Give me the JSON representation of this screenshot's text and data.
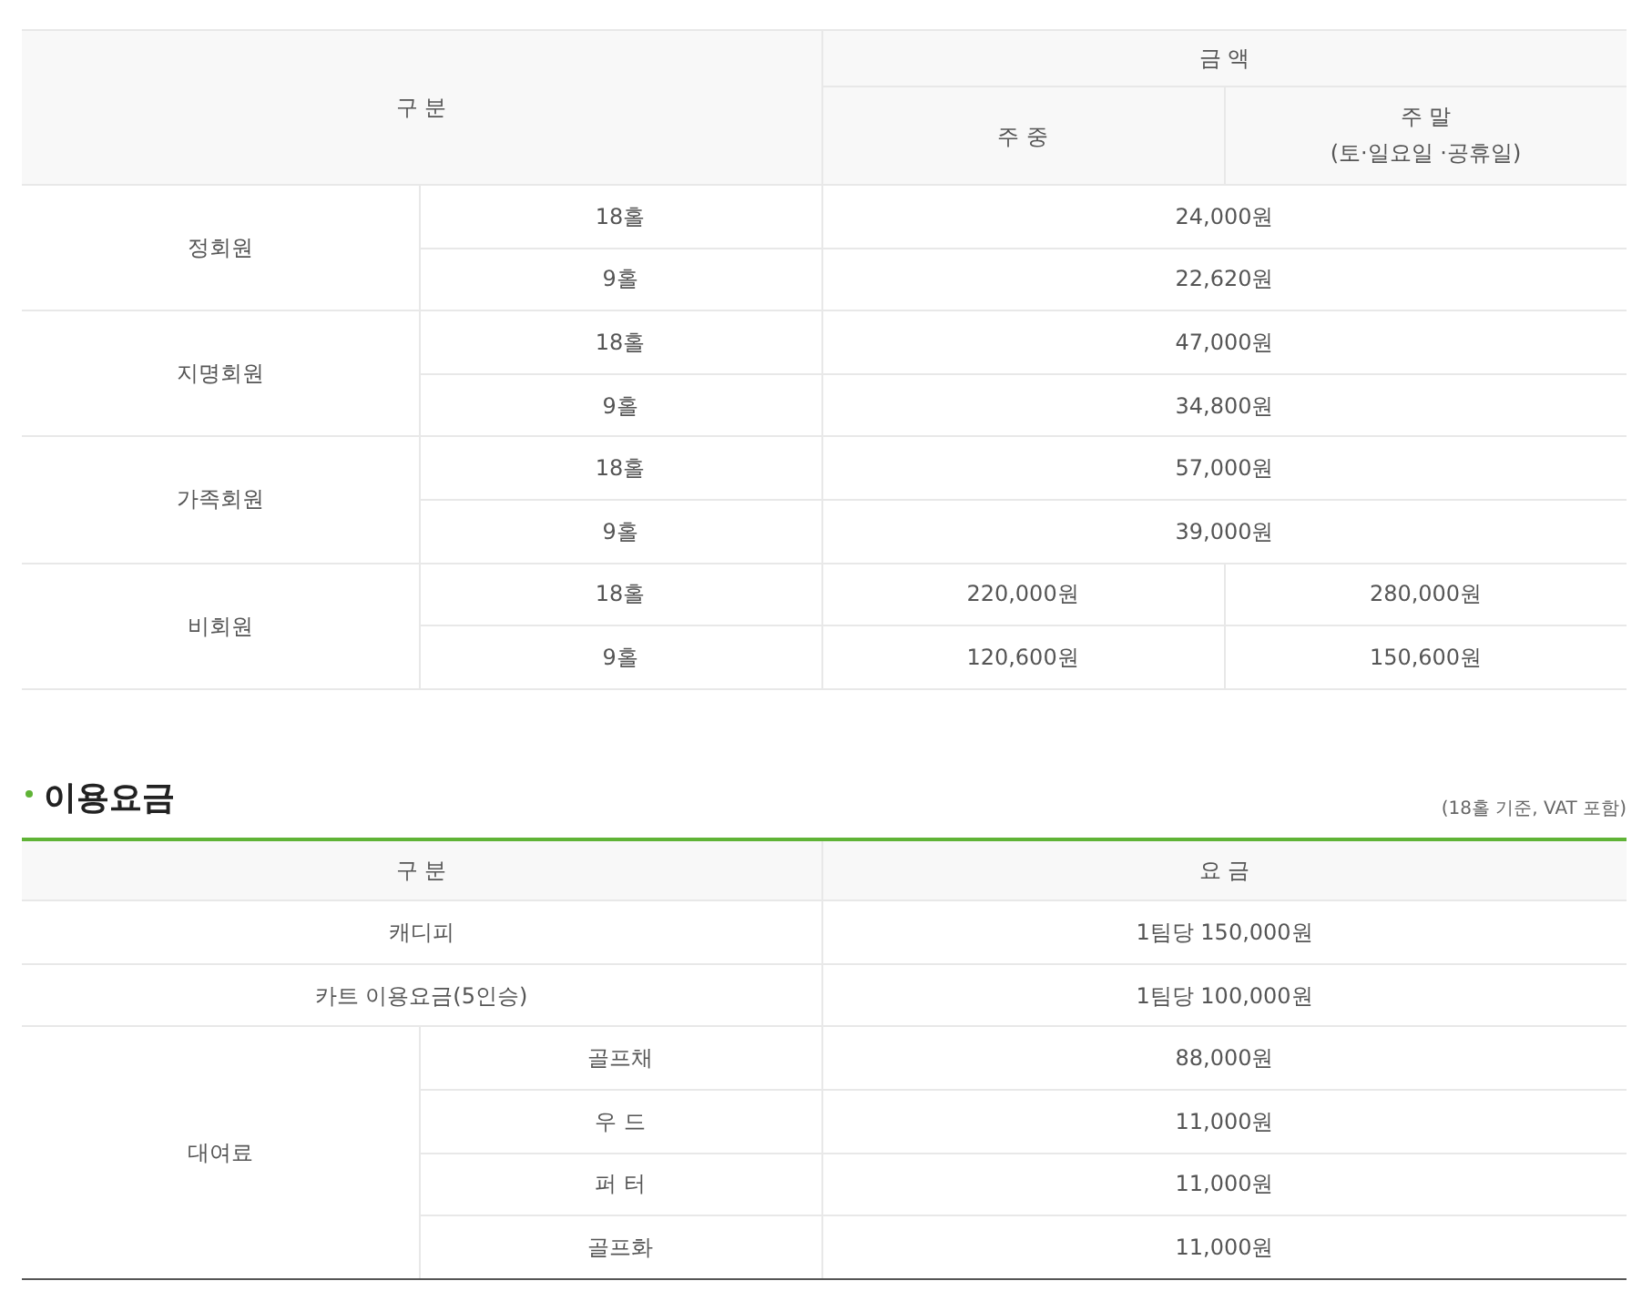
{
  "green_fee_table": {
    "columns": {
      "category": "구 분",
      "amount": "금 액",
      "weekday": "주 중",
      "weekend": "주 말",
      "weekend_note": "(토·일요일 ·공휴일)"
    },
    "groups": [
      {
        "label": "정회원",
        "rows": [
          {
            "holes": "18홀",
            "prices": [
              "24,000원"
            ]
          },
          {
            "holes": "9홀",
            "prices": [
              "22,620원"
            ]
          }
        ]
      },
      {
        "label": "지명회원",
        "rows": [
          {
            "holes": "18홀",
            "prices": [
              "47,000원"
            ]
          },
          {
            "holes": "9홀",
            "prices": [
              "34,800원"
            ]
          }
        ]
      },
      {
        "label": "가족회원",
        "rows": [
          {
            "holes": "18홀",
            "prices": [
              "57,000원"
            ]
          },
          {
            "holes": "9홀",
            "prices": [
              "39,000원"
            ]
          }
        ]
      },
      {
        "label": "비회원",
        "rows": [
          {
            "holes": "18홀",
            "prices": [
              "220,000원",
              "280,000원"
            ]
          },
          {
            "holes": "9홀",
            "prices": [
              "120,600원",
              "150,600원"
            ]
          }
        ]
      }
    ]
  },
  "usage_fees": {
    "title": "이용요금",
    "note": "(18홀 기준, VAT 포함)",
    "columns": {
      "category": "구 분",
      "fee": "요 금"
    },
    "items": [
      {
        "label": "캐디피",
        "price": "1팀당 150,000원"
      },
      {
        "label": "카트 이용요금(5인승)",
        "price": "1팀당 100,000원"
      },
      {
        "label": "대여료",
        "children": [
          {
            "label": "골프채",
            "price": "88,000원"
          },
          {
            "label": "우 드",
            "price": "11,000원"
          },
          {
            "label": "퍼 터",
            "price": "11,000원"
          },
          {
            "label": "골프화",
            "price": "11,000원"
          }
        ]
      }
    ]
  }
}
